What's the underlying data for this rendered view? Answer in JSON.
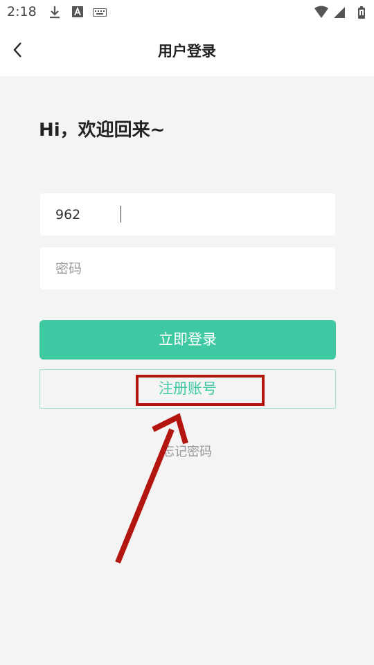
{
  "status_bar": {
    "time": "2:18",
    "left_icons": [
      "download-icon",
      "font-a-icon",
      "keyboard-icon"
    ],
    "right_icons": [
      "wifi-icon",
      "cell-signal-icon",
      "battery-icon"
    ]
  },
  "app_bar": {
    "back_icon": "chevron-left-icon",
    "title": "用户登录"
  },
  "greeting": "Hi，欢迎回来~",
  "form": {
    "username_value": "962",
    "password_placeholder": "密码",
    "login_label": "立即登录",
    "register_label": "注册账号",
    "forgot_label": "忘记密码"
  },
  "annotation": {
    "color": "#b3150f",
    "target": "register-button"
  },
  "colors": {
    "accent": "#3fc9a3",
    "background": "#f4f4f4"
  }
}
